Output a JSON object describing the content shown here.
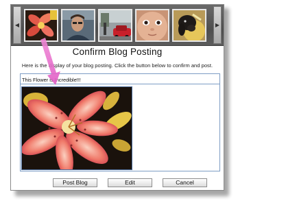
{
  "thumbnails": [
    {
      "name": "flower"
    },
    {
      "name": "man-portrait"
    },
    {
      "name": "street-car"
    },
    {
      "name": "baby-face"
    },
    {
      "name": "dog"
    }
  ],
  "icons": {
    "scroll_left": "◀",
    "scroll_right": "▶"
  },
  "dialog": {
    "title": "Confirm Blog Posting",
    "instructions": "Here is the display of your blog posting. Click the button below to confirm and post.",
    "post_caption": "This Flower is Incredible!!!"
  },
  "buttons": {
    "post": "Post Blog",
    "edit": "Edit",
    "cancel": "Cancel"
  },
  "colors": {
    "arrow": "#ee66cc",
    "panel_border": "#7c9cc4"
  }
}
